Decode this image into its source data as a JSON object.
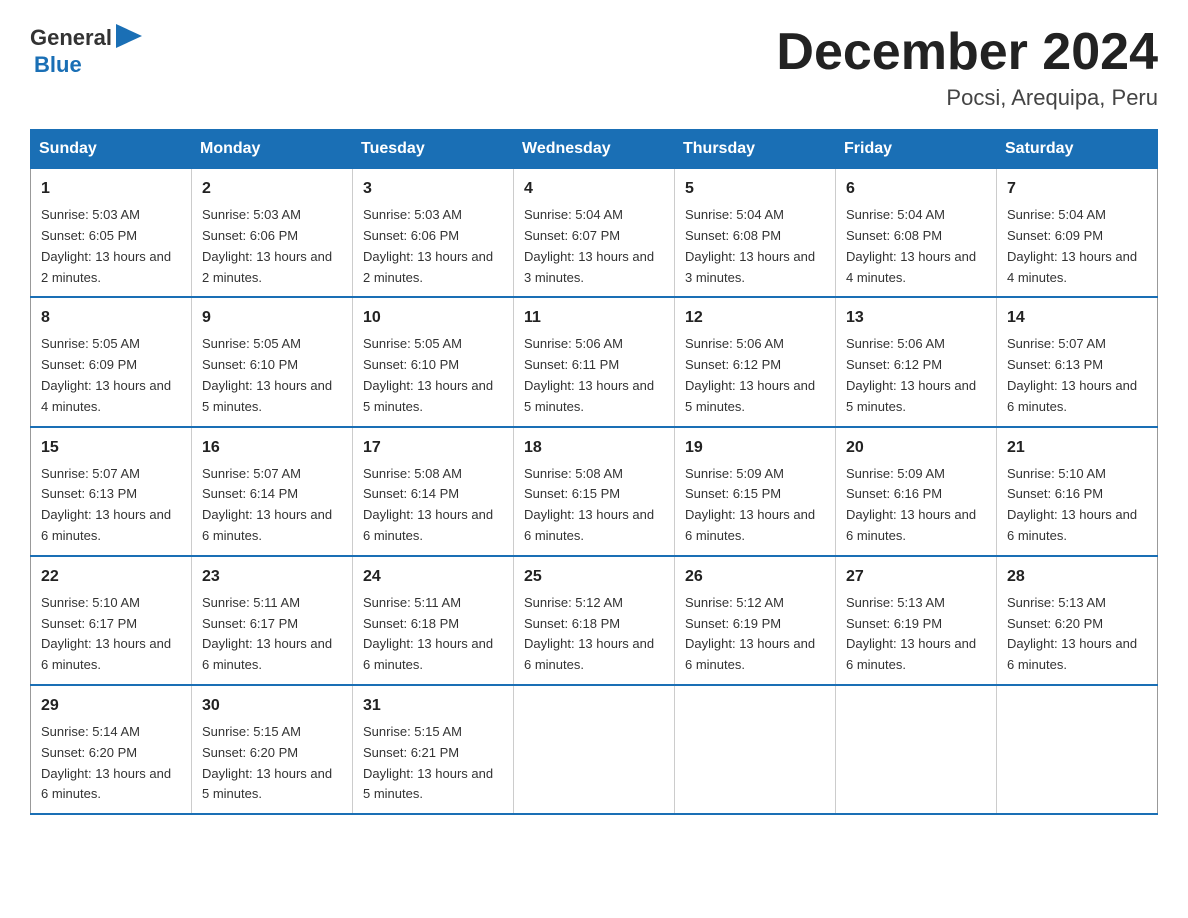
{
  "logo": {
    "text_general": "General",
    "text_blue": "Blue",
    "alt": "GeneralBlue logo"
  },
  "title": "December 2024",
  "location": "Pocsi, Arequipa, Peru",
  "days_of_week": [
    "Sunday",
    "Monday",
    "Tuesday",
    "Wednesday",
    "Thursday",
    "Friday",
    "Saturday"
  ],
  "weeks": [
    [
      {
        "day": "1",
        "sunrise": "5:03 AM",
        "sunset": "6:05 PM",
        "daylight": "13 hours and 2 minutes."
      },
      {
        "day": "2",
        "sunrise": "5:03 AM",
        "sunset": "6:06 PM",
        "daylight": "13 hours and 2 minutes."
      },
      {
        "day": "3",
        "sunrise": "5:03 AM",
        "sunset": "6:06 PM",
        "daylight": "13 hours and 2 minutes."
      },
      {
        "day": "4",
        "sunrise": "5:04 AM",
        "sunset": "6:07 PM",
        "daylight": "13 hours and 3 minutes."
      },
      {
        "day": "5",
        "sunrise": "5:04 AM",
        "sunset": "6:08 PM",
        "daylight": "13 hours and 3 minutes."
      },
      {
        "day": "6",
        "sunrise": "5:04 AM",
        "sunset": "6:08 PM",
        "daylight": "13 hours and 4 minutes."
      },
      {
        "day": "7",
        "sunrise": "5:04 AM",
        "sunset": "6:09 PM",
        "daylight": "13 hours and 4 minutes."
      }
    ],
    [
      {
        "day": "8",
        "sunrise": "5:05 AM",
        "sunset": "6:09 PM",
        "daylight": "13 hours and 4 minutes."
      },
      {
        "day": "9",
        "sunrise": "5:05 AM",
        "sunset": "6:10 PM",
        "daylight": "13 hours and 5 minutes."
      },
      {
        "day": "10",
        "sunrise": "5:05 AM",
        "sunset": "6:10 PM",
        "daylight": "13 hours and 5 minutes."
      },
      {
        "day": "11",
        "sunrise": "5:06 AM",
        "sunset": "6:11 PM",
        "daylight": "13 hours and 5 minutes."
      },
      {
        "day": "12",
        "sunrise": "5:06 AM",
        "sunset": "6:12 PM",
        "daylight": "13 hours and 5 minutes."
      },
      {
        "day": "13",
        "sunrise": "5:06 AM",
        "sunset": "6:12 PM",
        "daylight": "13 hours and 5 minutes."
      },
      {
        "day": "14",
        "sunrise": "5:07 AM",
        "sunset": "6:13 PM",
        "daylight": "13 hours and 6 minutes."
      }
    ],
    [
      {
        "day": "15",
        "sunrise": "5:07 AM",
        "sunset": "6:13 PM",
        "daylight": "13 hours and 6 minutes."
      },
      {
        "day": "16",
        "sunrise": "5:07 AM",
        "sunset": "6:14 PM",
        "daylight": "13 hours and 6 minutes."
      },
      {
        "day": "17",
        "sunrise": "5:08 AM",
        "sunset": "6:14 PM",
        "daylight": "13 hours and 6 minutes."
      },
      {
        "day": "18",
        "sunrise": "5:08 AM",
        "sunset": "6:15 PM",
        "daylight": "13 hours and 6 minutes."
      },
      {
        "day": "19",
        "sunrise": "5:09 AM",
        "sunset": "6:15 PM",
        "daylight": "13 hours and 6 minutes."
      },
      {
        "day": "20",
        "sunrise": "5:09 AM",
        "sunset": "6:16 PM",
        "daylight": "13 hours and 6 minutes."
      },
      {
        "day": "21",
        "sunrise": "5:10 AM",
        "sunset": "6:16 PM",
        "daylight": "13 hours and 6 minutes."
      }
    ],
    [
      {
        "day": "22",
        "sunrise": "5:10 AM",
        "sunset": "6:17 PM",
        "daylight": "13 hours and 6 minutes."
      },
      {
        "day": "23",
        "sunrise": "5:11 AM",
        "sunset": "6:17 PM",
        "daylight": "13 hours and 6 minutes."
      },
      {
        "day": "24",
        "sunrise": "5:11 AM",
        "sunset": "6:18 PM",
        "daylight": "13 hours and 6 minutes."
      },
      {
        "day": "25",
        "sunrise": "5:12 AM",
        "sunset": "6:18 PM",
        "daylight": "13 hours and 6 minutes."
      },
      {
        "day": "26",
        "sunrise": "5:12 AM",
        "sunset": "6:19 PM",
        "daylight": "13 hours and 6 minutes."
      },
      {
        "day": "27",
        "sunrise": "5:13 AM",
        "sunset": "6:19 PM",
        "daylight": "13 hours and 6 minutes."
      },
      {
        "day": "28",
        "sunrise": "5:13 AM",
        "sunset": "6:20 PM",
        "daylight": "13 hours and 6 minutes."
      }
    ],
    [
      {
        "day": "29",
        "sunrise": "5:14 AM",
        "sunset": "6:20 PM",
        "daylight": "13 hours and 6 minutes."
      },
      {
        "day": "30",
        "sunrise": "5:15 AM",
        "sunset": "6:20 PM",
        "daylight": "13 hours and 5 minutes."
      },
      {
        "day": "31",
        "sunrise": "5:15 AM",
        "sunset": "6:21 PM",
        "daylight": "13 hours and 5 minutes."
      },
      null,
      null,
      null,
      null
    ]
  ]
}
